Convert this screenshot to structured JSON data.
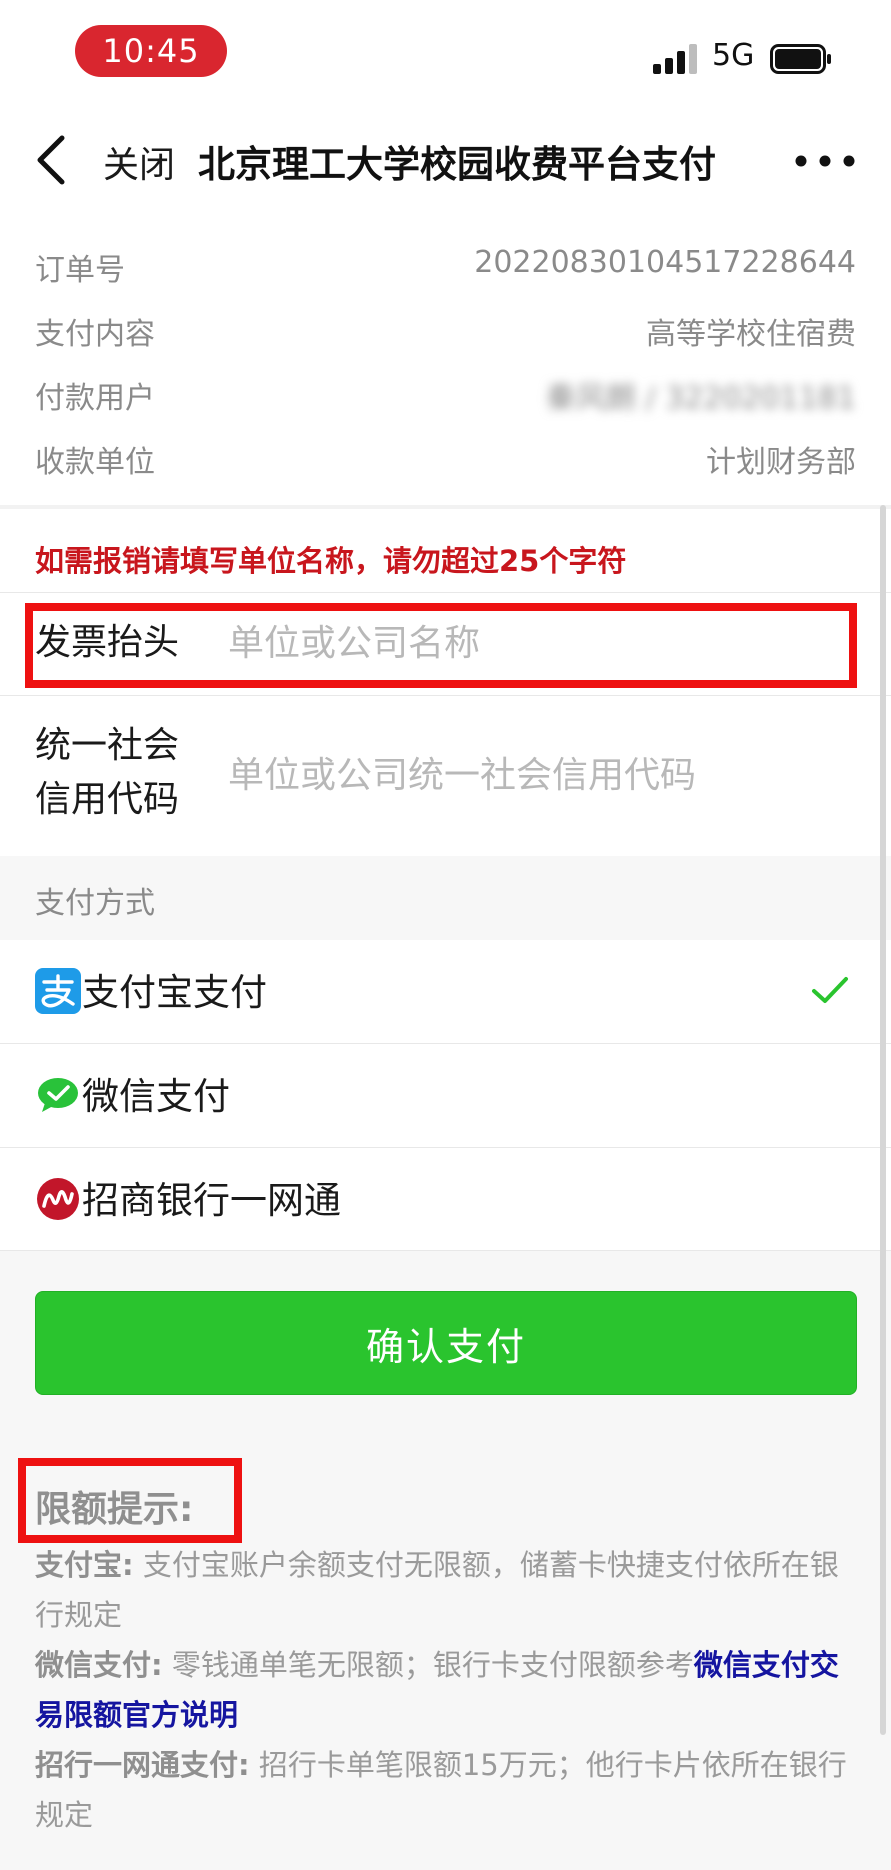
{
  "status_bar": {
    "time": "10:45",
    "network": "5G"
  },
  "nav": {
    "close_label": "关闭",
    "title": "北京理工大学校园收费平台支付"
  },
  "order": [
    {
      "label": "订单号",
      "value": "20220830104517228644"
    },
    {
      "label": "支付内容",
      "value": "高等学校住宿费"
    },
    {
      "label": "付款用户",
      "value": "秦风朗 / 3220201181"
    },
    {
      "label": "收款单位",
      "value": "计划财务部"
    }
  ],
  "invoice": {
    "note": "如需报销请填写单位名称，请勿超过25个字符",
    "title_label": "发票抬头",
    "title_placeholder": "单位或公司名称",
    "credit_label_line1": "统一社会",
    "credit_label_line2": "信用代码",
    "credit_placeholder": "单位或公司统一社会信用代码"
  },
  "payment": {
    "section_title": "支付方式",
    "methods": [
      {
        "label": "支付宝支付",
        "icon": "alipay-icon",
        "color": "#1e9be8",
        "selected": true
      },
      {
        "label": "微信支付",
        "icon": "wechat-icon",
        "color": "#29c23a",
        "selected": false
      },
      {
        "label": "招商银行一网通",
        "icon": "cmb-icon",
        "color": "#c2162a",
        "selected": false
      }
    ],
    "check_color": "#2ac42e"
  },
  "confirm_label": "确认支付",
  "limits": {
    "title": "限额提示:",
    "alipay_prefix": "支付宝:",
    "alipay_text": "支付宝账户余额支付无限额，储蓄卡快捷支付依所在银行规定",
    "wechat_prefix": "微信支付:",
    "wechat_text": "零钱通单笔无限额；银行卡支付限额参考",
    "wechat_link": "微信支付交易限额官方说明",
    "cmb_prefix": "招行一网通支付:",
    "cmb_text": "招行卡单笔限额15万元；他行卡片依所在银行规定"
  },
  "colors": {
    "accent_red": "#ee1111",
    "confirm_green": "#2ac42e",
    "note_red": "#c8161d",
    "link_blue": "#1515a0"
  }
}
